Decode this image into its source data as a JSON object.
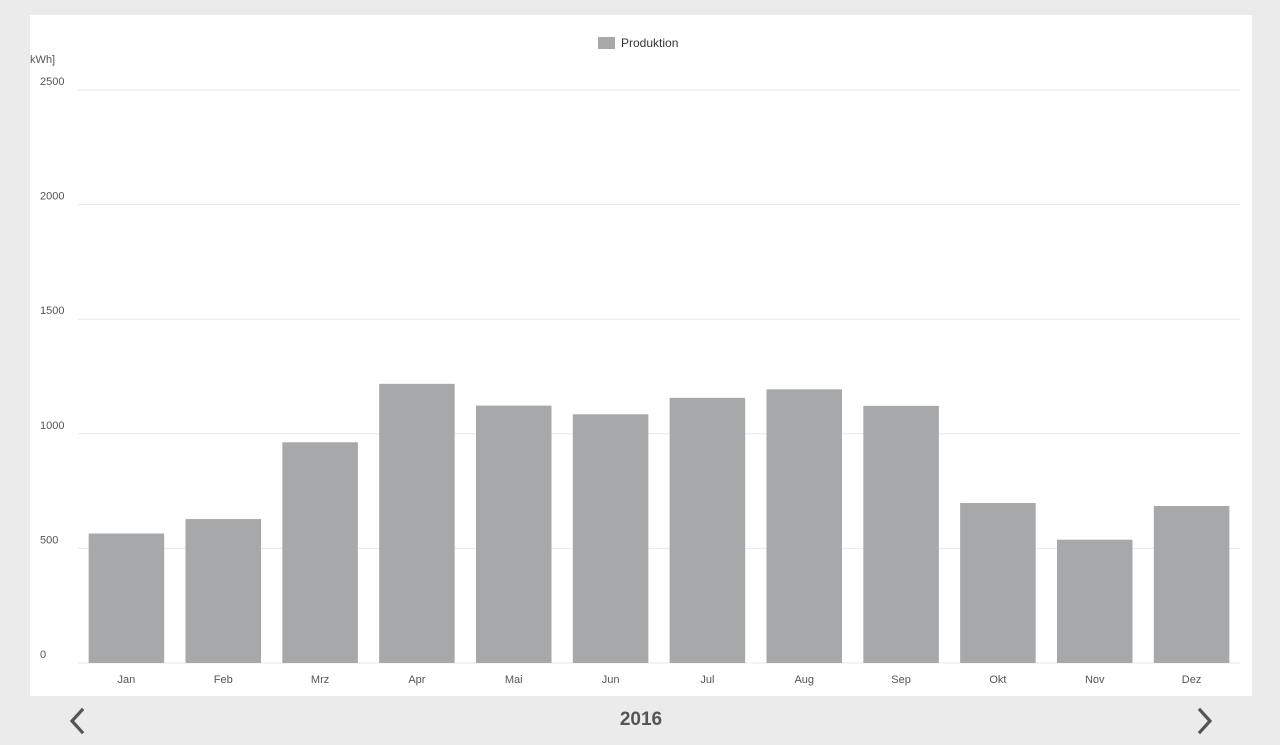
{
  "chart_data": {
    "type": "bar",
    "unit_label": "[kWh]",
    "categories": [
      "Jan",
      "Feb",
      "Mrz",
      "Apr",
      "Mai",
      "Jun",
      "Jul",
      "Aug",
      "Sep",
      "Okt",
      "Nov",
      "Dez"
    ],
    "series": [
      {
        "name": "Produktion",
        "color": "#a7a8a9",
        "values": [
          565,
          628,
          963,
          1218,
          1123,
          1085,
          1157,
          1194,
          1122,
          698,
          538,
          685
        ]
      }
    ],
    "ylim": [
      0,
      2500
    ],
    "yticks": [
      "0",
      "500",
      "1000",
      "1500",
      "2000",
      "2500"
    ],
    "grid": true,
    "legend_position": "top-center"
  },
  "footer": {
    "year": "2016",
    "prev_icon": "chevron-left-icon",
    "next_icon": "chevron-right-icon"
  }
}
